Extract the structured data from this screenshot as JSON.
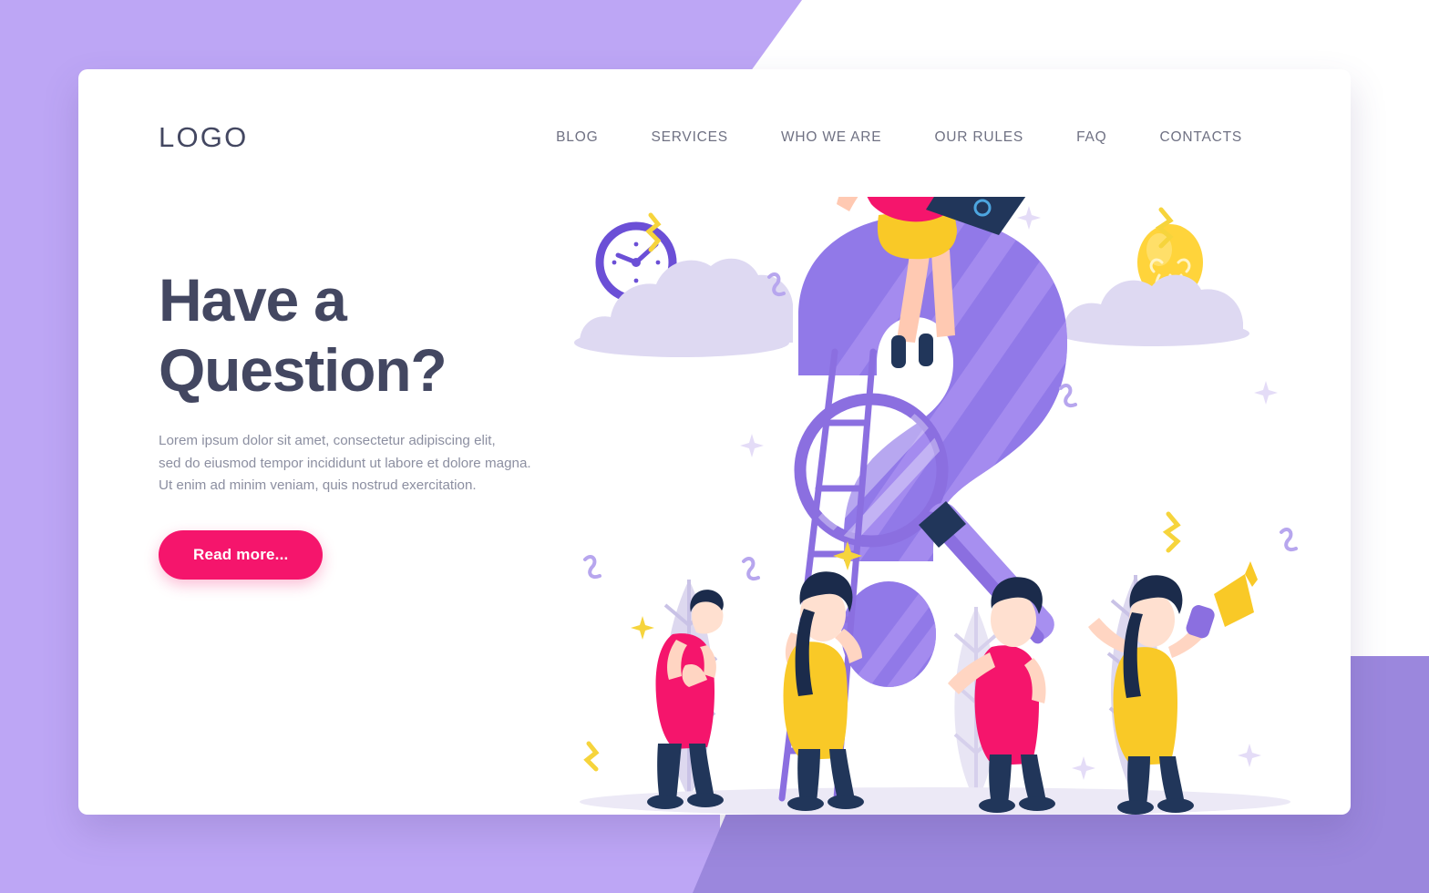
{
  "page": {
    "background_color": "#bda6f5",
    "background_accent_color": "#9b87dd",
    "card_color": "#ffffff"
  },
  "header": {
    "logo": "LOGO",
    "logo_color": "#434761",
    "nav": [
      {
        "label": "BLOG"
      },
      {
        "label": "SERVICES"
      },
      {
        "label": "WHO WE ARE"
      },
      {
        "label": "OUR RULES"
      },
      {
        "label": "FAQ"
      },
      {
        "label": "CONTACTS"
      }
    ],
    "nav_color": "#6f7183"
  },
  "hero": {
    "headline_line1": "Have a",
    "headline_line2": "Question?",
    "headline_color": "#434761",
    "paragraph_line1": "Lorem ipsum dolor sit amet, consectetur adipiscing elit,",
    "paragraph_line2": "sed do eiusmod tempor incididunt ut labore et dolore magna.",
    "paragraph_line3": "Ut enim ad minim veniam, quis nostrud exercitation.",
    "paragraph_color": "#8c8fa1",
    "cta_label": "Read more...",
    "cta_color": "#f5156c",
    "cta_text_color": "#ffffff"
  },
  "illustration": {
    "name": "question-mark-scene",
    "description": "Giant purple question mark with people, ladder, magnifying glass, clouds, clock, lightbulb and trees",
    "colors": {
      "question_mark": "#9179e8",
      "question_mark_shade": "#a78ff0",
      "cloud": "#ded9f2",
      "tree": "#ddd8ef",
      "ladder": "#8b6fe0",
      "clock_ring": "#6b4fd6",
      "bulb": "#ffd43b",
      "shirt_pink": "#f5156c",
      "shirt_yellow": "#f9c927",
      "pants_navy": "#223martin",
      "pants": "#21365a",
      "hair": "#1b2b4b",
      "skin": "#ffd5c2",
      "ground": "#ece9f6",
      "squiggle_yellow": "#f6d43c",
      "squiggle_purple": "#b7a6ee"
    },
    "elements": [
      {
        "name": "woman-with-laptop",
        "position": "top-center"
      },
      {
        "name": "clock",
        "position": "left"
      },
      {
        "name": "lightbulb",
        "position": "right"
      },
      {
        "name": "thinking-man",
        "position": "left"
      },
      {
        "name": "woman-on-ladder",
        "position": "center-left"
      },
      {
        "name": "man-with-pencil",
        "position": "center-right"
      },
      {
        "name": "woman-with-megaphone",
        "position": "right"
      },
      {
        "name": "ladder",
        "position": "center-left"
      },
      {
        "name": "magnifying-glass",
        "position": "center"
      }
    ]
  }
}
